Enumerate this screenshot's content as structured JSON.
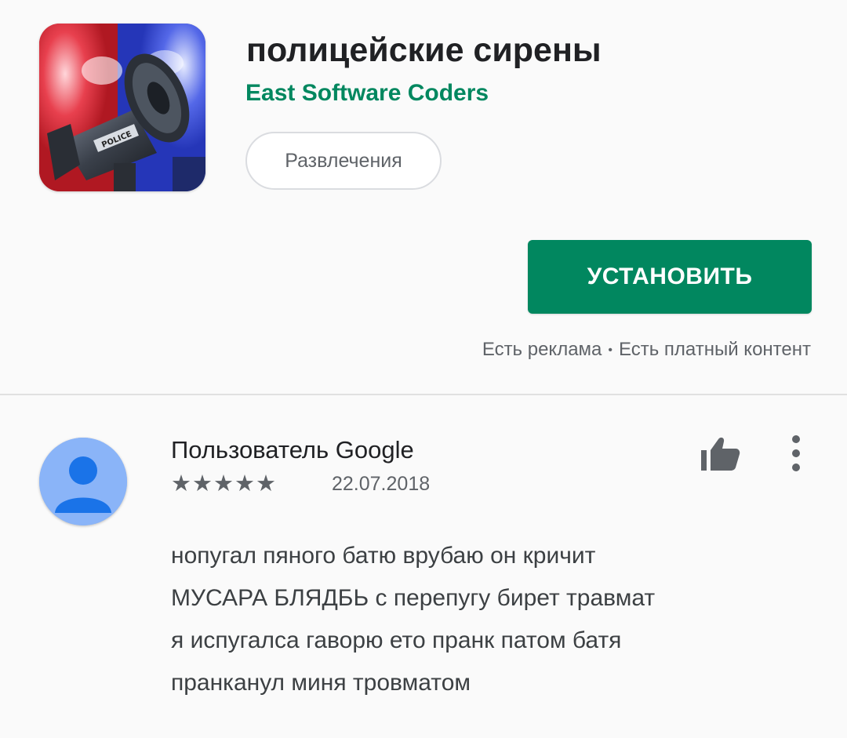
{
  "app": {
    "title": "полицейские сирены",
    "developer": "East Software Coders",
    "category": "Развлечения",
    "install_label": "УСТАНОВИТЬ",
    "disclaimer_ads": "Есть реклама",
    "disclaimer_separator": "•",
    "disclaimer_paid": "Есть платный контент",
    "icon": "police-megaphone-icon",
    "icon_badge_text": "POLICE"
  },
  "review": {
    "author": "Пользователь Google",
    "stars": "★★★★★",
    "rating": 5,
    "date": "22.07.2018",
    "lines": [
      "нопугал пяного батю врубаю он кричит",
      "МУСАРА БЛЯДБЬ с перепугу бирет травмат",
      "я испугалса гаворю ето пранк патом батя",
      "пранканул миня тровматом"
    ]
  },
  "colors": {
    "accent_green": "#01875f",
    "avatar_blue": "#8ab4f8",
    "avatar_figure": "#1a73e8"
  }
}
